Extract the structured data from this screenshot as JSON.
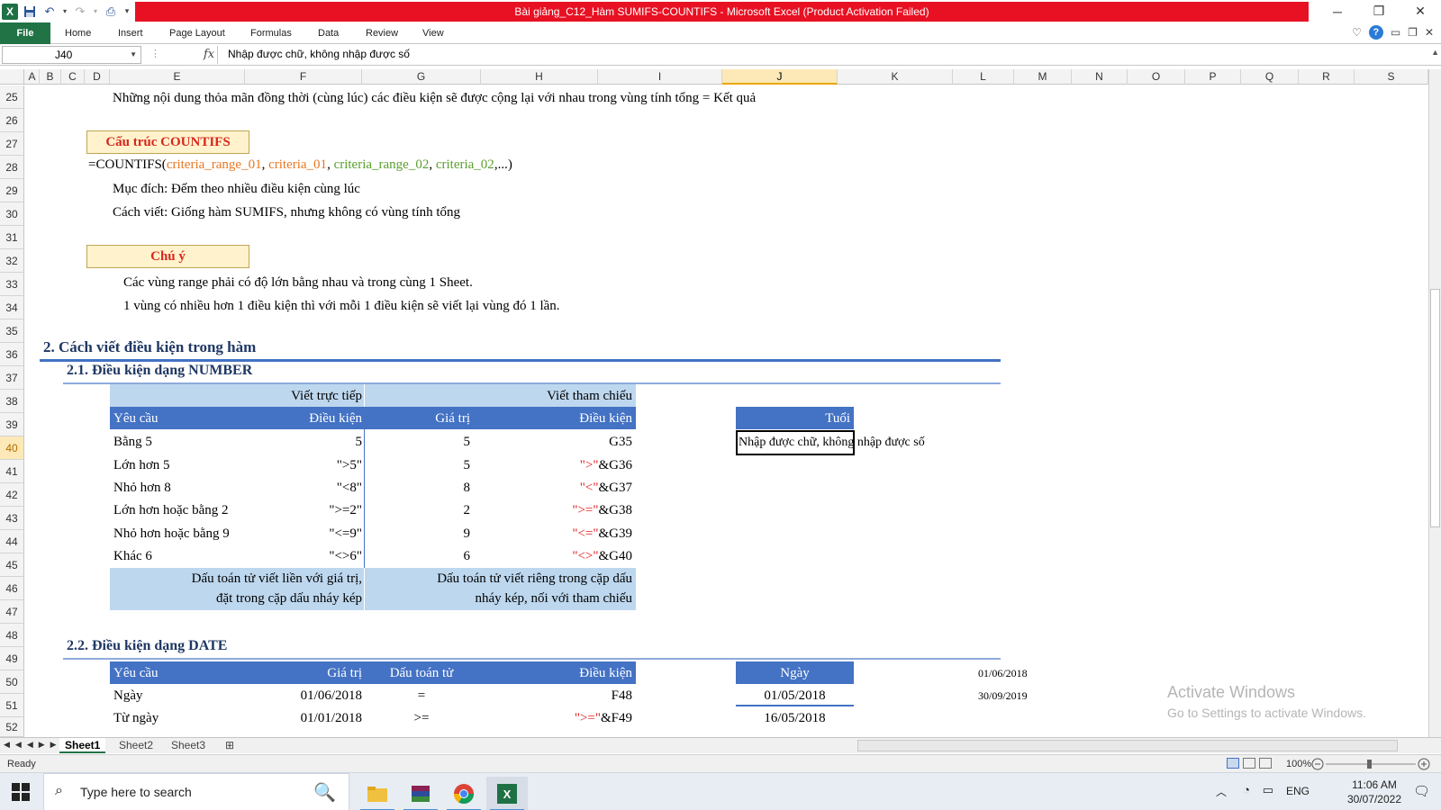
{
  "window": {
    "title": "Bài giảng_C12_Hàm SUMIFS-COUNTIFS  -  Microsoft Excel (Product Activation Failed)"
  },
  "ribbon": {
    "tabs": [
      "File",
      "Home",
      "Insert",
      "Page Layout",
      "Formulas",
      "Data",
      "Review",
      "View"
    ]
  },
  "formula_bar": {
    "name_box": "J40",
    "fx": "fx",
    "formula": "Nhập được chữ, không nhập được số"
  },
  "columns": [
    "A",
    "B",
    "C",
    "D",
    "E",
    "F",
    "G",
    "H",
    "I",
    "J",
    "K",
    "L",
    "M",
    "N",
    "O",
    "P",
    "Q",
    "R",
    "S"
  ],
  "rows": [
    "25",
    "26",
    "27",
    "28",
    "29",
    "30",
    "31",
    "32",
    "33",
    "34",
    "35",
    "36",
    "37",
    "38",
    "39",
    "40",
    "41",
    "42",
    "43",
    "44",
    "45",
    "46",
    "47",
    "48",
    "49",
    "50",
    "51",
    "52"
  ],
  "content": {
    "r25": "Những nội dung thỏa mãn đồng thời (cùng lúc) các điều kiện sẽ được cộng lại với nhau trong vùng tính tổng = Kết quả",
    "countifs_box": "Cấu trúc COUNTIFS",
    "countifs_formula": {
      "prefix": "=COUNTIFS(",
      "arg1": "criteria_range_01",
      "sep": ", ",
      "arg2": "criteria_01",
      "arg3": "criteria_range_02",
      "arg4": "criteria_02",
      "suffix": ",...)"
    },
    "r29": "Mục đích: Đếm theo nhiều điều kiện cùng lúc",
    "r30": "Cách viết: Giống hàm SUMIFS, nhưng không có vùng tính tổng",
    "note_box": "Chú ý",
    "r33": "Các vùng range phải có độ lớn bằng nhau và trong cùng 1 Sheet.",
    "r34": "1 vùng có nhiều hơn 1 điều kiện thì với mỗi 1 điều kiện sẽ viết lại vùng đó 1 lần.",
    "h36": "2. Cách viết điều kiện trong hàm",
    "h37": "2.1. Điều kiện dạng NUMBER",
    "h49": "2.2. Điều kiện dạng DATE"
  },
  "number_table": {
    "group_left": "Viết trực tiếp",
    "group_right": "Viết tham chiếu",
    "headers": [
      "Yêu cầu",
      "Điều kiện",
      "Giá trị",
      "Điều kiện"
    ],
    "rows": [
      {
        "req": "Bằng 5",
        "cond": "5",
        "val": "5",
        "op": "",
        "ref": "G35"
      },
      {
        "req": "Lớn hơn 5",
        "cond": "\">5\"",
        "val": "5",
        "op": "\">\"",
        "ref": "&G36"
      },
      {
        "req": "Nhỏ hơn 8",
        "cond": "\"<8\"",
        "val": "8",
        "op": "\"<\"",
        "ref": "&G37"
      },
      {
        "req": "Lớn hơn hoặc bằng 2",
        "cond": "\">=2\"",
        "val": "2",
        "op": "\">=\"",
        "ref": "&G38"
      },
      {
        "req": "Nhỏ hơn hoặc bằng 9",
        "cond": "\"<=9\"",
        "val": "9",
        "op": "\"<=\"",
        "ref": "&G39"
      },
      {
        "req": "Khác 6",
        "cond": "\"<>6\"",
        "val": "6",
        "op": "\"<>\"",
        "ref": "&G40"
      }
    ],
    "note_left_1": "Dấu toán tử viết liền với giá trị,",
    "note_left_2": "đặt trong cặp dấu nháy kép",
    "note_right_1": "Dấu toán tử viết riêng trong cặp dấu",
    "note_right_2": "nháy kép, nối với tham chiếu"
  },
  "tuoi": {
    "header": "Tuổi",
    "value": "Nhập được chữ, không nhập được số"
  },
  "date_table": {
    "headers": [
      "Yêu cầu",
      "Giá trị",
      "Dấu toán tử",
      "Điều kiện"
    ],
    "rows": [
      {
        "req": "Ngày",
        "val": "01/06/2018",
        "op": "=",
        "cond_op": "",
        "cond_ref": "F48"
      },
      {
        "req": "Từ ngày",
        "val": "01/01/2018",
        "op": ">=",
        "cond_op": "\">=\"",
        "cond_ref": "&F49"
      }
    ]
  },
  "ngay": {
    "header": "Ngày",
    "values": [
      "01/05/2018",
      "16/05/2018"
    ]
  },
  "side_dates": [
    "01/06/2018",
    "30/09/2019"
  ],
  "watermark": {
    "line1": "Activate Windows",
    "line2": "Go to Settings to activate Windows."
  },
  "sheets": [
    "Sheet1",
    "Sheet2",
    "Sheet3"
  ],
  "status": {
    "ready": "Ready",
    "zoom": "100%"
  },
  "taskbar": {
    "search_placeholder": "Type here to search",
    "lang": "ENG",
    "time": "11:06 AM",
    "date": "30/07/2022"
  },
  "colors": {
    "header_blue": "#4472c4",
    "light_blue": "#bdd7ee",
    "title_red": "#e81123",
    "file_green": "#217346",
    "box_yellow": "#fff2cc",
    "orange_arg": "#e87722",
    "green_arg": "#5aa02c",
    "red_op": "#e0191a"
  }
}
